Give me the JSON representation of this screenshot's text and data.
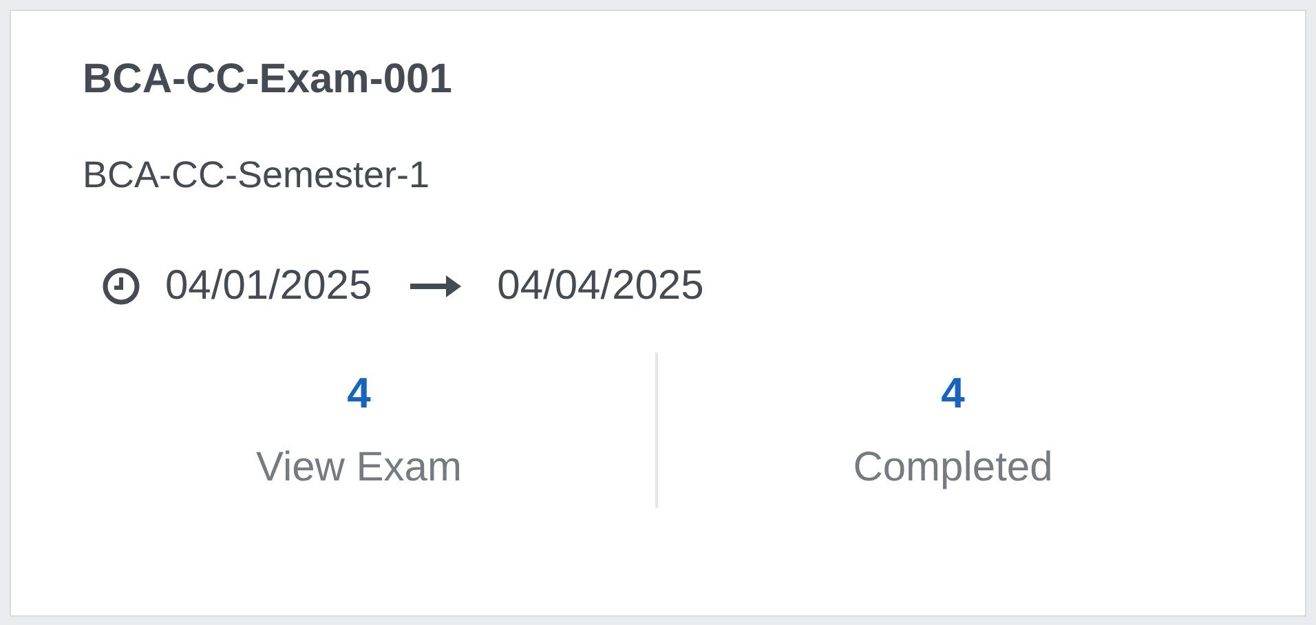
{
  "card": {
    "title": "BCA-CC-Exam-001",
    "subtitle": "BCA-CC-Semester-1",
    "start_date": "04/01/2025",
    "end_date": "04/04/2025",
    "stats": [
      {
        "value": "4",
        "label": "View Exam"
      },
      {
        "value": "4",
        "label": "Completed"
      }
    ]
  }
}
